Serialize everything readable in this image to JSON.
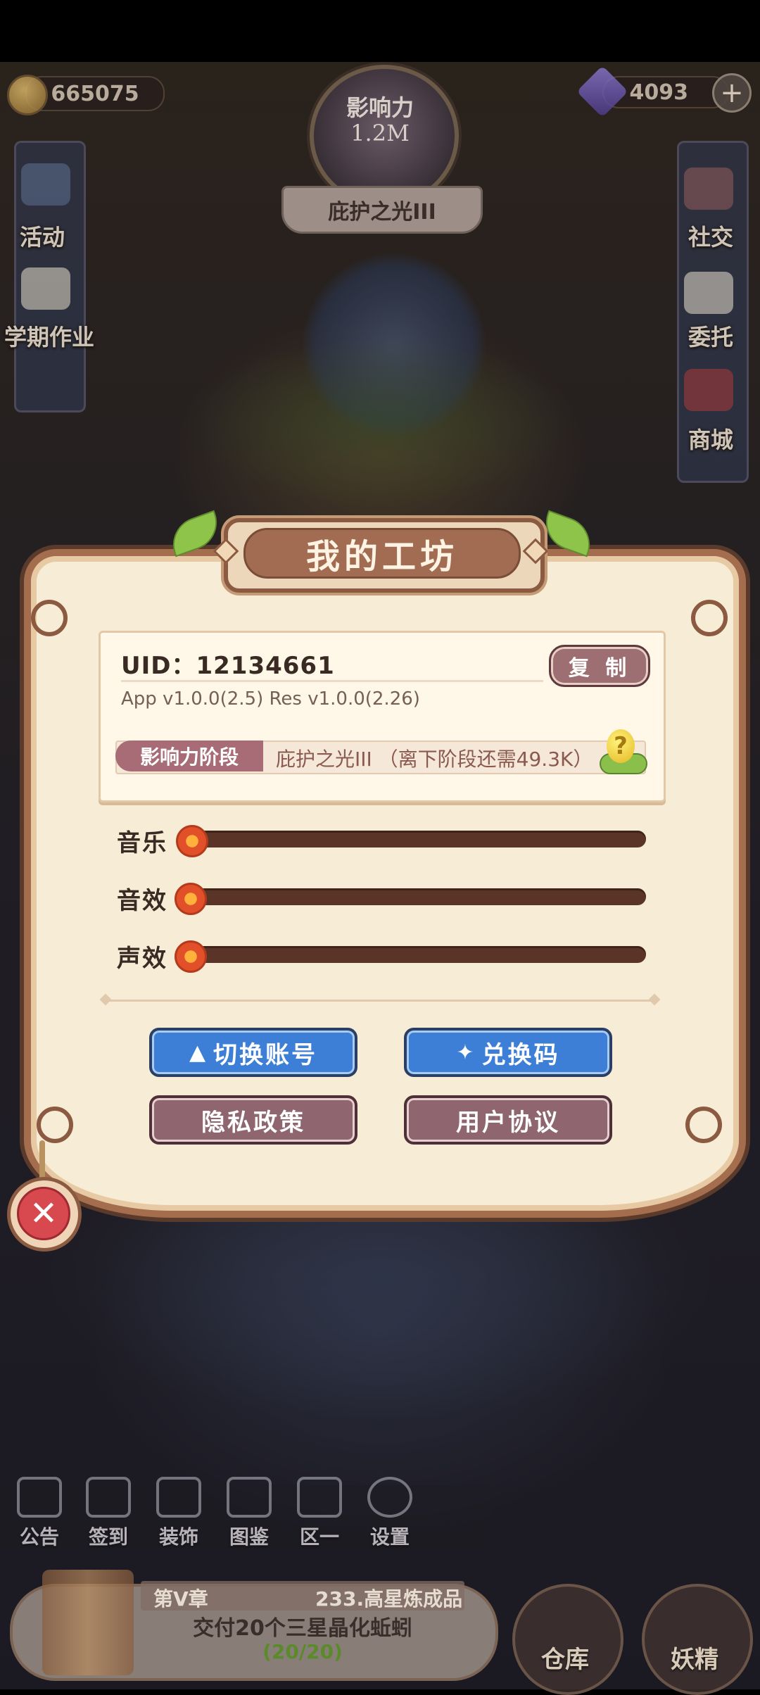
{
  "hud": {
    "coins": "665075",
    "gems": "4093",
    "plus": "+",
    "influence_title": "影响力",
    "influence_value": "1.2M",
    "rank_ribbon": "庇护之光III"
  },
  "side_left": [
    "活动",
    "学期作业"
  ],
  "side_right": [
    "社交",
    "委托",
    "商城"
  ],
  "dialog": {
    "title": "我的工坊",
    "uid": "UID：12134661",
    "copy_label": "复 制",
    "version": "App v1.0.0(2.5)   Res v1.0.0(2.26)",
    "stage_label": "影响力阶段",
    "stage_value": "庇护之光III （离下阶段还需49.3K）",
    "help_glyph": "?",
    "sliders": [
      {
        "label": "音乐",
        "value": 0
      },
      {
        "label": "音效",
        "value": 0
      },
      {
        "label": "声效",
        "value": 0
      }
    ],
    "buttons": {
      "switch_account": "切换账号",
      "redeem_code": "兑换码",
      "privacy_policy": "隐私政策",
      "user_agreement": "用户协议"
    },
    "close_glyph": "✕"
  },
  "bottom_nav": [
    "公告",
    "签到",
    "装饰",
    "图鉴",
    "区一",
    "设置"
  ],
  "quest": {
    "chapter": "第V章",
    "name": "233.高星炼成品",
    "task": "交付20个三星晶化蚯蚓",
    "progress": "(20/20)"
  },
  "bottom_buttons": [
    "仓库",
    "妖精"
  ],
  "colors": {
    "panel_bg": "#f7ecd6",
    "frame": "#a36d4e",
    "blue_button": "#3d7fd6",
    "mauve_button": "#8f6670",
    "slider_track": "#5a3427",
    "stage_label_bg": "#a76c76"
  }
}
